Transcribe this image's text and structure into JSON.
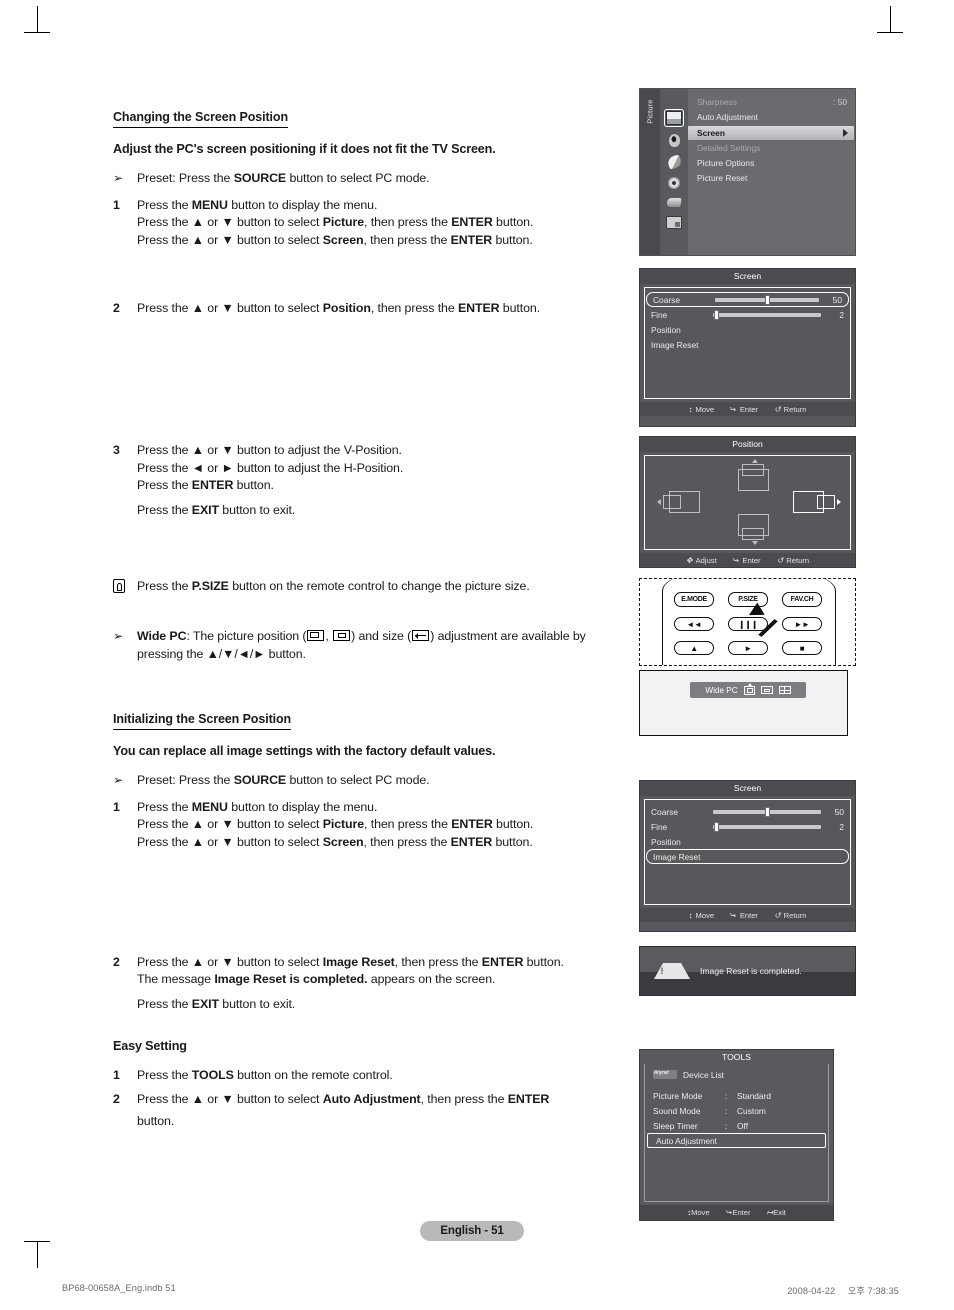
{
  "document": {
    "page_badge": "English - 51",
    "footer_left": "BP68-00658A_Eng.indb   51",
    "footer_date": "2008-04-22",
    "footer_time": "오후 7:38:35"
  },
  "sections": {
    "changing": {
      "heading": "Changing the Screen Position",
      "lead": "Adjust the PC's screen positioning if it does not fit the TV Screen.",
      "preset": {
        "marker": "➢",
        "t1": "Preset: Press the ",
        "b1": "SOURCE",
        "t2": " button to select PC mode."
      },
      "step1": {
        "marker": "1",
        "l1a": "Press the ",
        "l1b": "MENU",
        "l1c": " button to display the menu.",
        "l2a": "Press the ▲ or ▼ button to select ",
        "l2b": "Picture",
        "l2c": ", then press the ",
        "l2d": "ENTER",
        "l2e": " button.",
        "l3a": "Press the ▲ or ▼ button to select ",
        "l3b": "Screen",
        "l3c": ", then press the ",
        "l3d": "ENTER",
        "l3e": " button."
      },
      "step2": {
        "marker": "2",
        "a": "Press the ▲ or ▼ button to select ",
        "b": "Position",
        "c": ", then press the ",
        "d": "ENTER",
        "e": " button."
      },
      "step3": {
        "marker": "3",
        "l1": "Press the ▲ or ▼ button to adjust the V-Position.",
        "l2": "Press the ◄ or ► button to adjust the H-Position.",
        "l3a": "Press the ",
        "l3b": "ENTER",
        "l3c": " button.",
        "exit_a": "Press the ",
        "exit_b": "EXIT",
        "exit_c": " button to exit."
      },
      "psize_note": {
        "a": "Press the ",
        "b": "P.SIZE",
        "c": " button on the remote control to change the picture size."
      },
      "widepc_note": {
        "marker": "➢",
        "b1": "Wide PC",
        "t1": ": The picture position (",
        "t2": ", ",
        "t3": ") and size (",
        "t4": ") adjustment are available by",
        "t5": "pressing the ▲/▼/◄/► button."
      }
    },
    "initializing": {
      "heading": "Initializing the Screen Position",
      "lead": "You can replace all image settings with the factory default values.",
      "preset": {
        "marker": "➢",
        "t1": "Preset: Press the ",
        "b1": "SOURCE",
        "t2": " button to select PC mode."
      },
      "step1": {
        "marker": "1",
        "l1a": "Press the ",
        "l1b": "MENU",
        "l1c": " button to display the menu.",
        "l2a": "Press the ▲ or ▼ button to select ",
        "l2b": "Picture",
        "l2c": ", then press the ",
        "l2d": "ENTER",
        "l2e": " button.",
        "l3a": "Press the ▲ or ▼ button to select ",
        "l3b": "Screen",
        "l3c": ", then press the ",
        "l3d": "ENTER",
        "l3e": " button."
      },
      "step2": {
        "marker": "2",
        "l1a": "Press the ▲ or ▼ button to select ",
        "l1b": "Image Reset",
        "l1c": ", then press the ",
        "l1d": "ENTER",
        "l1e": " button.",
        "l2a": "The message ",
        "l2b": "Image Reset is completed.",
        "l2c": " appears on the screen.",
        "exit_a": "Press the ",
        "exit_b": "EXIT",
        "exit_c": " button to exit."
      }
    },
    "easy_setting": {
      "heading": "Easy Setting",
      "step1": {
        "marker": "1",
        "a": "Press the ",
        "b": "TOOLS",
        "c": " button on the remote control."
      },
      "step2": {
        "marker": "2",
        "a": "Press the ▲ or ▼ button to select ",
        "b": "Auto Adjustment",
        "c": ", then press the ",
        "d": "ENTER",
        "e": "button."
      }
    }
  },
  "osd": {
    "picture_menu": {
      "tab_label": "Picture",
      "items": [
        {
          "label": "Sharpness",
          "value": ": 50",
          "state": "dim"
        },
        {
          "label": "Auto Adjustment",
          "value": "",
          "state": "normal"
        },
        {
          "label": "Screen",
          "value": "",
          "state": "selected"
        },
        {
          "label": "Detailed Settings",
          "value": "",
          "state": "dim"
        },
        {
          "label": "Picture Options",
          "value": "",
          "state": "normal"
        },
        {
          "label": "Picture Reset",
          "value": "",
          "state": "normal"
        }
      ],
      "sidebar_icons": [
        "picture-icon",
        "sound-icon",
        "channel-icon",
        "setup-icon",
        "input-icon",
        "media-icon"
      ]
    },
    "screen_panel_1": {
      "title": "Screen",
      "rows": [
        {
          "label": "Coarse",
          "value": "50",
          "type": "slider",
          "pct": 50,
          "highlight": true
        },
        {
          "label": "Fine",
          "value": "2",
          "type": "slider",
          "pct": 2,
          "highlight": false
        },
        {
          "label": "Position",
          "value": "",
          "type": "item",
          "highlight": false
        },
        {
          "label": "Image Reset",
          "value": "",
          "type": "item",
          "highlight": false
        }
      ],
      "footer": {
        "move": "Move",
        "enter": "Enter",
        "return": "Return"
      }
    },
    "position_panel": {
      "title": "Position",
      "icons": [
        "position-up-icon",
        "position-down-icon",
        "position-left-icon",
        "position-right-icon"
      ],
      "active_icon": "position-right-icon",
      "footer": {
        "adjust": "Adjust",
        "enter": "Enter",
        "return": "Return"
      }
    },
    "remote": {
      "buttons_row1": [
        "E.MODE",
        "P.SIZE",
        "FAV.CH"
      ],
      "buttons_row2": [
        "◄◄",
        "❙❙❙",
        "►►"
      ],
      "buttons_row3": [
        "▲",
        "►",
        "■"
      ],
      "pointer_target": "P.SIZE"
    },
    "wide_pc": {
      "label": "Wide PC",
      "icons": [
        "position-adjust-icon",
        "size-icon",
        "split-icon"
      ]
    },
    "screen_panel_2": {
      "title": "Screen",
      "rows": [
        {
          "label": "Coarse",
          "value": "50",
          "type": "slider",
          "pct": 50,
          "highlight": false
        },
        {
          "label": "Fine",
          "value": "2",
          "type": "slider",
          "pct": 2,
          "highlight": false
        },
        {
          "label": "Position",
          "value": "",
          "type": "item",
          "highlight": false
        },
        {
          "label": "Image Reset",
          "value": "",
          "type": "item",
          "highlight": true
        }
      ],
      "footer": {
        "move": "Move",
        "enter": "Enter",
        "return": "Return"
      }
    },
    "message_box": {
      "icon": "warning-icon",
      "text": "Image Reset is completed."
    },
    "tools_menu": {
      "title": "TOOLS",
      "device_list": {
        "badge": "Anynet",
        "label": "Device List"
      },
      "rows": [
        {
          "label": "Picture Mode",
          "colon": ":",
          "value": "Standard"
        },
        {
          "label": "Sound Mode",
          "colon": ":",
          "value": "Custom"
        },
        {
          "label": "Sleep Timer",
          "colon": ":",
          "value": "Off"
        }
      ],
      "selected": "Auto Adjustment",
      "footer": {
        "move": "Move",
        "enter": "Enter",
        "exit": "Exit"
      }
    }
  }
}
